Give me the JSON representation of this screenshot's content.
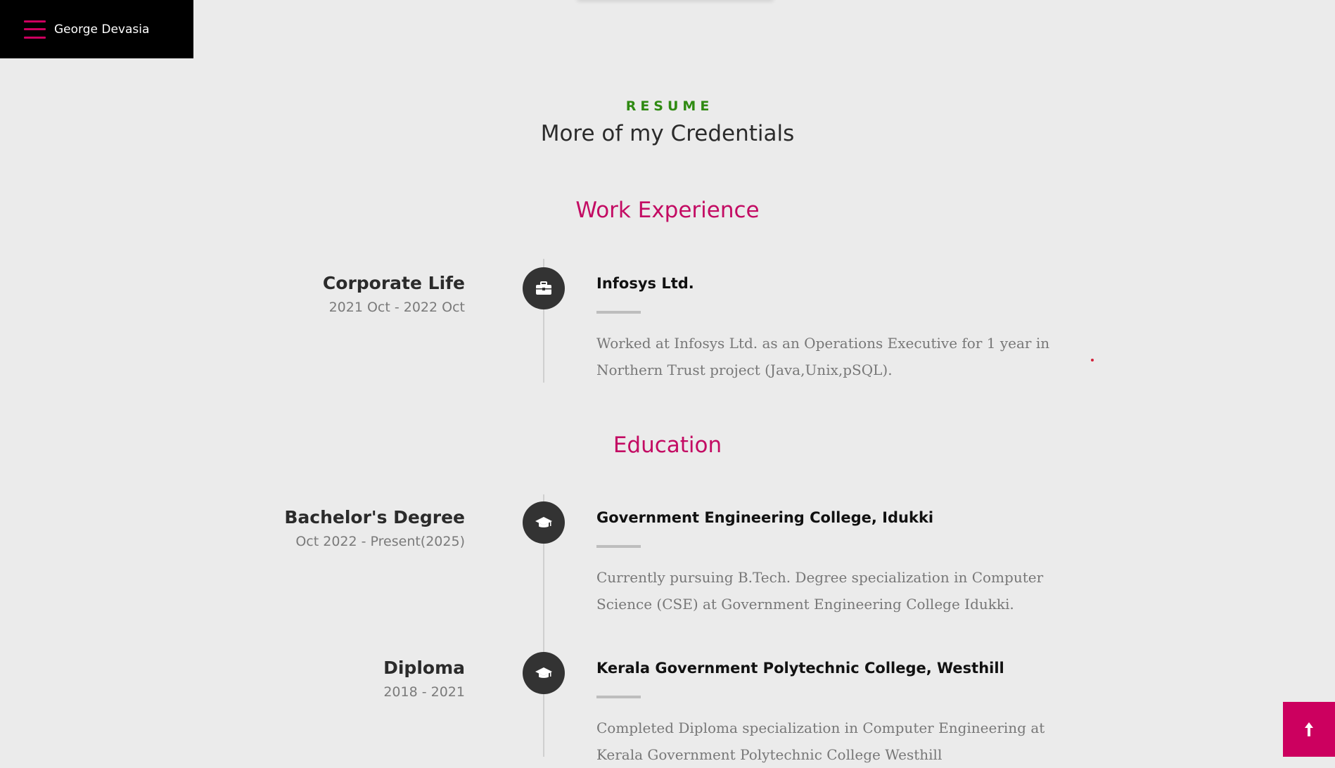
{
  "header": {
    "name": "George Devasia",
    "menu_icon": "hamburger-menu-icon"
  },
  "resume": {
    "eyebrow": "RESUME",
    "title": "More of my Credentials"
  },
  "work": {
    "title": "Work Experience",
    "items": [
      {
        "role": "Corporate Life",
        "dates": "2021 Oct - 2022 Oct",
        "icon": "briefcase-icon",
        "org": "Infosys Ltd.",
        "description": "Worked at Infosys Ltd. as an Operations Executive for 1 year in Northern Trust project (Java,Unix,pSQL)."
      }
    ]
  },
  "education": {
    "title": "Education",
    "items": [
      {
        "role": "Bachelor's Degree",
        "dates": "Oct 2022 - Present(2025)",
        "icon": "graduation-cap-icon",
        "org": "Government Engineering College, Idukki",
        "description": "Currently pursuing B.Tech. Degree specialization in Computer Science (CSE) at Government Engineering College Idukki."
      },
      {
        "role": "Diploma",
        "dates": "2018 - 2021",
        "icon": "graduation-cap-icon",
        "org": "Kerala Government Polytechnic College, Westhill",
        "description": "Completed Diploma specialization in Computer Engineering at Kerala Government Polytechnic College Westhill"
      }
    ]
  },
  "back_to_top": {
    "icon": "arrow-up-icon"
  },
  "colors": {
    "accent": "#cc005f",
    "eyebrow": "#2f8a12",
    "background": "#ebebeb",
    "header_bg": "#000000"
  }
}
